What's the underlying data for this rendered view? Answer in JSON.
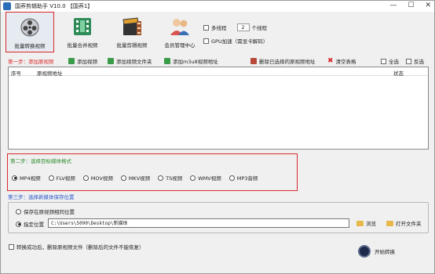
{
  "window": {
    "title": "国荞剪辑助手 V10.0 【国荞1】",
    "controls": [
      "—",
      "☐",
      "✕"
    ]
  },
  "toolbar": {
    "tools": [
      {
        "label": "批量转换视频",
        "icon": "film-reel-icon"
      },
      {
        "label": "批量合并视频",
        "icon": "film-merge-icon"
      },
      {
        "label": "批量剪辑视频",
        "icon": "clapperboard-icon"
      },
      {
        "label": "会员管理中心",
        "icon": "users-icon"
      }
    ],
    "multithread_label": "多线程",
    "thread_count": "2",
    "thread_unit": "个线程",
    "gpu_label": "GPU加速（需显卡解码）"
  },
  "step1": {
    "title": "第一步：添加原视频",
    "buttons": [
      "添加视频",
      "添加视频文件夹",
      "添加m3u8视频地址",
      "删除已选择的原视频地址",
      "清空表格"
    ],
    "select_all": "全选",
    "invert": "反选",
    "columns": [
      "序号",
      "原视频地址",
      "状态"
    ]
  },
  "step2": {
    "title": "第二步：选择目标媒体格式",
    "formats": [
      "MP4视频",
      "FLV视频",
      "MOV视频",
      "MKV视频",
      "TS视频",
      "WMV视频",
      "MP3音频"
    ],
    "selected": "MP4视频"
  },
  "step3": {
    "title": "第三步：选择新媒体保存位置",
    "same_location": "保存在原视频相同位置",
    "custom_location": "指定位置",
    "path": "C:\\Users\\5090\\Desktop\\新媒体",
    "browse": "浏览",
    "open_folder": "打开文件夹"
  },
  "footer": {
    "delete_after": "转换成功后，删除原视频文件（删除后的文件不能恢复）",
    "start": "开始转换"
  }
}
